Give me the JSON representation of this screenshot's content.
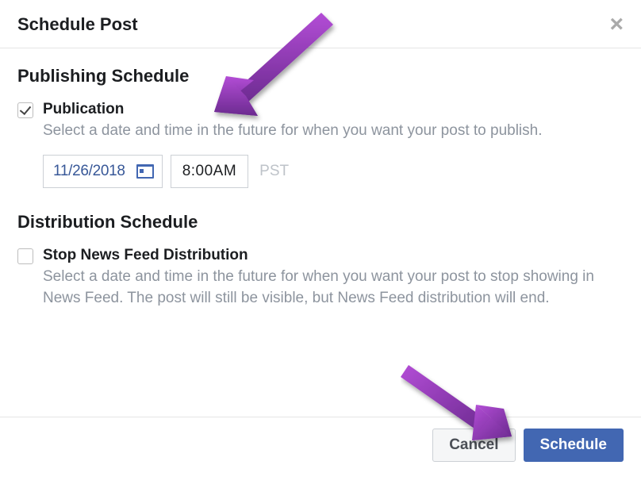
{
  "header": {
    "title": "Schedule Post"
  },
  "publishing": {
    "section_title": "Publishing Schedule",
    "option_label": "Publication",
    "option_desc": "Select a date and time in the future for when you want your post to publish.",
    "date": "11/26/2018",
    "time": "8:00AM",
    "timezone": "PST",
    "checked": true
  },
  "distribution": {
    "section_title": "Distribution Schedule",
    "option_label": "Stop News Feed Distribution",
    "option_desc": "Select a date and time in the future for when you want your post to stop showing in News Feed. The post will still be visible, but News Feed distribution will end.",
    "checked": false
  },
  "footer": {
    "cancel": "Cancel",
    "schedule": "Schedule"
  }
}
